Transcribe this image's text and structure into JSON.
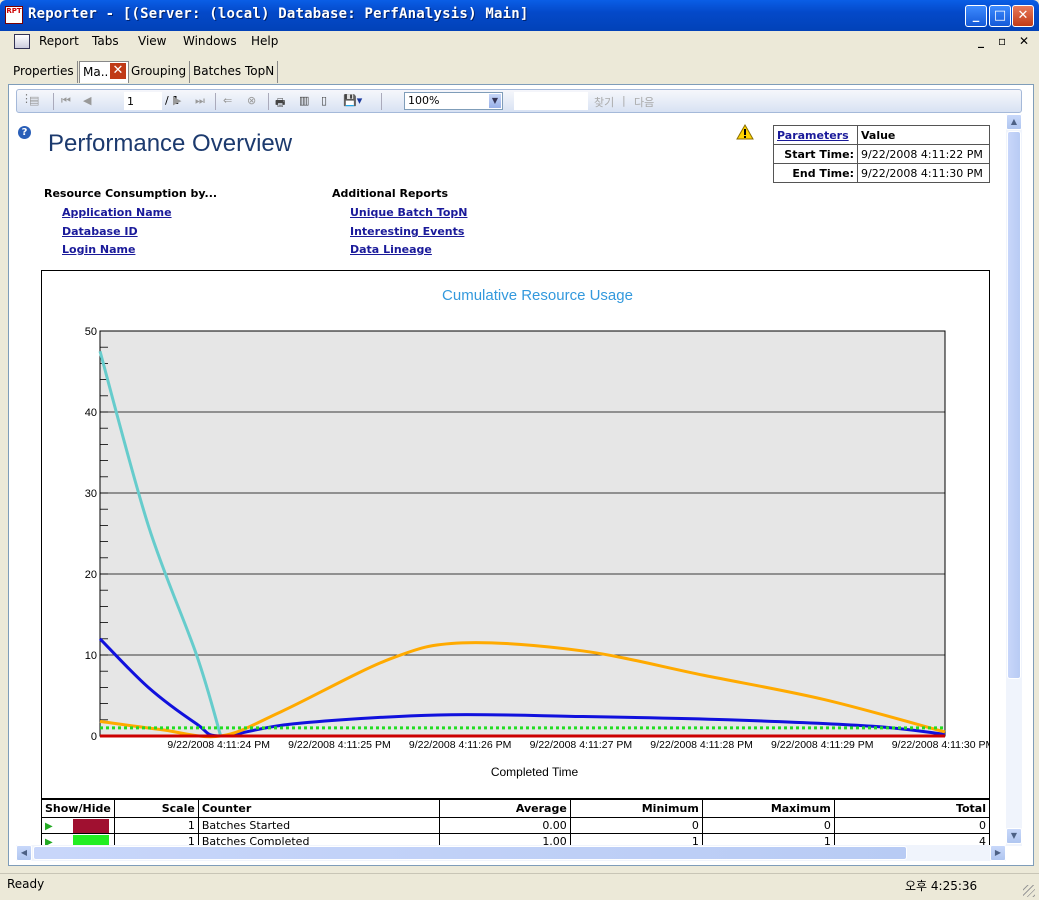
{
  "window": {
    "title": "Reporter - [(Server: (local) Database: PerfAnalysis) Main]"
  },
  "menu": {
    "items": [
      "Report",
      "Tabs",
      "View",
      "Windows",
      "Help"
    ]
  },
  "tabs": [
    {
      "label": "Properties"
    },
    {
      "label": "Ma..."
    },
    {
      "label": "Grouping"
    },
    {
      "label": "Batches TopN"
    }
  ],
  "toolbar": {
    "page_current": "1",
    "page_total": "/ 1",
    "zoom": "100%",
    "find_label": "찾기",
    "next_label": "다음",
    "separator": "|"
  },
  "report": {
    "title": "Performance Overview",
    "sections": {
      "resource": {
        "header": "Resource Consumption by...",
        "links": [
          "Application Name",
          "Database ID",
          "Login Name"
        ]
      },
      "additional": {
        "header": "Additional Reports",
        "links": [
          "Unique Batch TopN",
          "Interesting Events",
          "Data Lineage"
        ]
      }
    },
    "parameters": {
      "header_name": "Parameters",
      "header_value": "Value",
      "rows": [
        {
          "name": "Start Time:",
          "value": "9/22/2008 4:11:22 PM"
        },
        {
          "name": "End Time:",
          "value": "9/22/2008 4:11:30 PM"
        }
      ]
    }
  },
  "chart_data": {
    "type": "line",
    "title": "Cumulative Resource Usage",
    "xlabel": "Completed Time",
    "ylabel": "",
    "ylim": [
      0,
      50
    ],
    "yticks": [
      "0",
      "10",
      "20",
      "30",
      "40",
      "50"
    ],
    "categories": [
      "9/22/2008 4:11:24 PM",
      "9/22/2008 4:11:25 PM",
      "9/22/2008 4:11:26 PM",
      "9/22/2008 4:11:27 PM",
      "9/22/2008 4:11:28 PM",
      "9/22/2008 4:11:29 PM",
      "9/22/2008 4:11:30 PM"
    ],
    "grid": true,
    "series": [
      {
        "color": "#66cccc",
        "points": [
          [
            0,
            47.5
          ],
          [
            0.4,
            26
          ],
          [
            0.8,
            10
          ],
          [
            1.0,
            0
          ]
        ]
      },
      {
        "color": "#1111dd",
        "points": [
          [
            0,
            12
          ],
          [
            0.4,
            6
          ],
          [
            0.8,
            1.5
          ],
          [
            1.0,
            0
          ],
          [
            1.6,
            1.5
          ],
          [
            2.8,
            2.6
          ],
          [
            4.0,
            2.4
          ],
          [
            5.2,
            2.0
          ],
          [
            6.4,
            1.2
          ],
          [
            7.0,
            0.2
          ]
        ]
      },
      {
        "color": "#ffaa00",
        "points": [
          [
            0,
            1.8
          ],
          [
            0.5,
            0.8
          ],
          [
            1.0,
            0
          ],
          [
            1.5,
            3
          ],
          [
            2.4,
            9.5
          ],
          [
            3.0,
            11.5
          ],
          [
            4.0,
            10.5
          ],
          [
            5.0,
            7.5
          ],
          [
            6.0,
            4.5
          ],
          [
            7.0,
            0.5
          ]
        ]
      },
      {
        "color": "#cc0000",
        "points": [
          [
            0,
            0
          ],
          [
            7.0,
            0
          ]
        ]
      },
      {
        "color": "#22dd22",
        "dashed": true,
        "points": [
          [
            0,
            1
          ],
          [
            7.0,
            1
          ]
        ]
      }
    ]
  },
  "grid": {
    "headers": [
      "Show/Hide",
      "Scale",
      "Counter",
      "Average",
      "Minimum",
      "Maximum",
      "Total"
    ],
    "rows": [
      {
        "color": "#a01030",
        "scale": "1",
        "counter": "Batches Started",
        "average": "0.00",
        "minimum": "0",
        "maximum": "0",
        "total": "0"
      },
      {
        "color": "#22ee22",
        "scale": "1",
        "counter": "Batches Completed",
        "average": "1.00",
        "minimum": "1",
        "maximum": "1",
        "total": "4"
      }
    ]
  },
  "status": {
    "text": "Ready",
    "clock": "오후 4:25:36"
  }
}
